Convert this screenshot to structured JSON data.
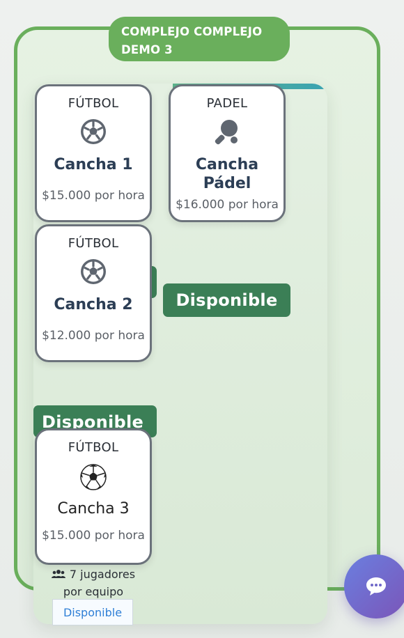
{
  "complex": {
    "title": "COMPLEJO COMPLEJO DEMO 3"
  },
  "courts": [
    {
      "sport": "FÚTBOL",
      "icon": "soccer-ball-icon",
      "name": "Cancha 1",
      "price": "$15.000 por hora"
    },
    {
      "sport": "PADEL",
      "icon": "paddle-racket-icon",
      "name": "Cancha Pádel",
      "price": "$16.000 por hora"
    },
    {
      "sport": "FÚTBOL",
      "icon": "soccer-ball-icon",
      "name": "Cancha 2",
      "price": "$12.000 por hora"
    },
    {
      "sport": "FÚTBOL",
      "icon": "soccer-ball-emoji-icon",
      "name": "Cancha 3",
      "price": "$15.000 por hora",
      "players": "7 jugadores por equipo",
      "status": "Disponible"
    }
  ],
  "badges": {
    "right": "Disponible",
    "bottom": "Disponible"
  },
  "chat": {
    "icon": "chat-bubble-icon"
  },
  "colors": {
    "frame_green": "#6aaf5c",
    "badge_green": "#3b7f56",
    "chat_gradient_start": "#6a7fe0",
    "chat_gradient_end": "#7b55b8"
  }
}
